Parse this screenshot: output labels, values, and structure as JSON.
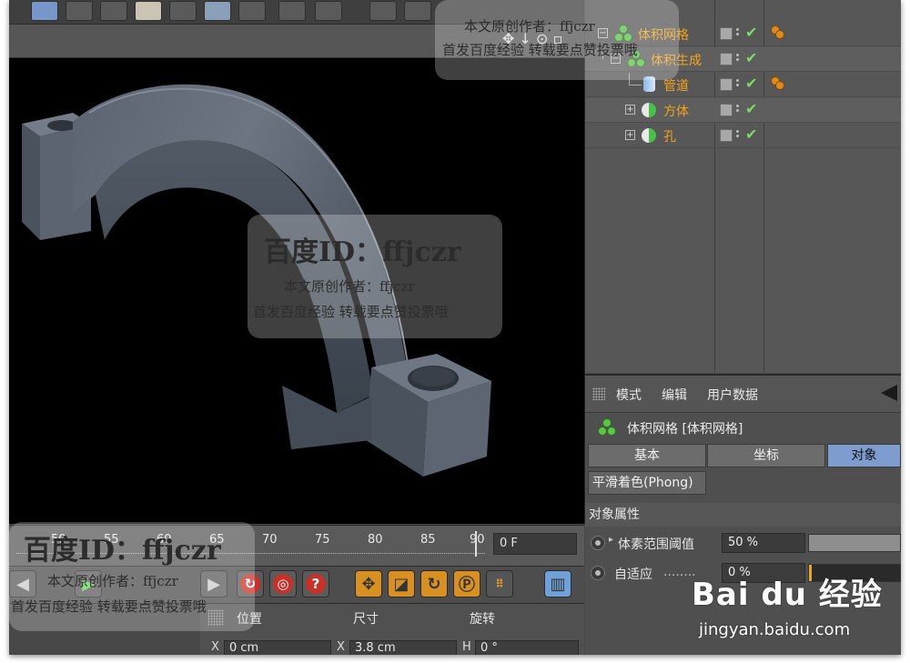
{
  "object_manager": {
    "objects": [
      {
        "name": "体积网格",
        "icon": "volume-mesher-icon"
      },
      {
        "name": "体积生成",
        "icon": "volume-builder-icon"
      },
      {
        "name": "管道",
        "icon": "tube-icon"
      },
      {
        "name": "方体",
        "icon": "cube-icon"
      },
      {
        "name": "孔",
        "icon": "hole-icon"
      }
    ]
  },
  "attributes": {
    "menu": [
      "模式",
      "编辑",
      "用户数据"
    ],
    "title": "体积网格 [体积网格]",
    "tabs": [
      "基本",
      "坐标",
      "对象"
    ],
    "active_tab": "对象",
    "phong_tab": "平滑着色(Phong)",
    "section": "对象属性",
    "props": [
      {
        "label": "体素范围阈值",
        "value": "50 %"
      },
      {
        "label": "自适应",
        "dots": "........",
        "value": "0 %"
      }
    ]
  },
  "timeline": {
    "ticks": [
      "50",
      "55",
      "60",
      "65",
      "70",
      "75",
      "80",
      "85",
      "90"
    ],
    "frame_field": "0 F"
  },
  "coords": {
    "headers": [
      "位置",
      "尺寸",
      "旋转"
    ],
    "row": [
      {
        "label": "X",
        "value": "0 cm"
      },
      {
        "label": "X",
        "value": "3.8 cm"
      },
      {
        "label": "H",
        "value": "0 °"
      }
    ]
  },
  "watermark": {
    "id_line": "百度ID：ffjczr",
    "author_line": "本文原创作者：ffjczr",
    "notice_line": "首发百度经验 转载要点赞投票哦"
  },
  "baidu": {
    "logo": "Bai du 经验",
    "url": "jingyan.baidu.com"
  }
}
